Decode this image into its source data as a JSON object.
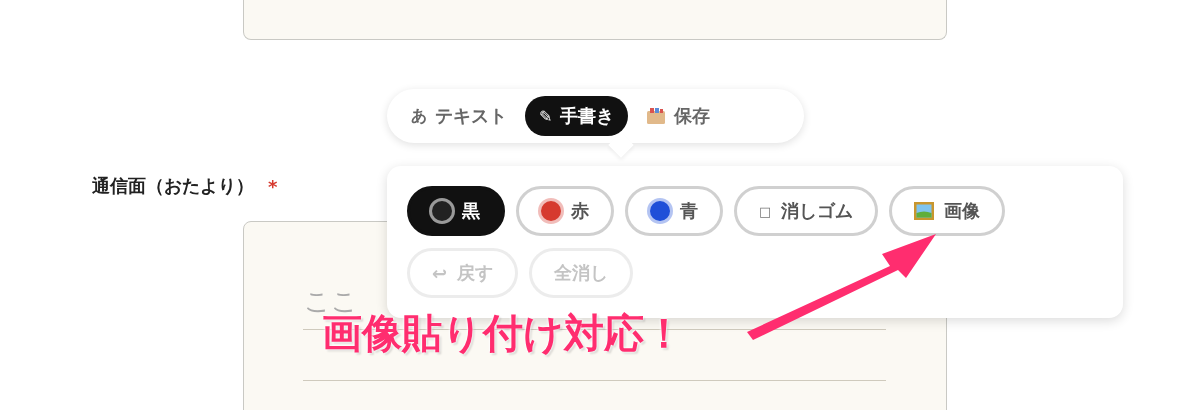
{
  "modes": [
    {
      "icon": "あ",
      "label": "テキスト",
      "kind": "text",
      "selected": false
    },
    {
      "icon": "✎",
      "label": "手書き",
      "kind": "draw",
      "selected": true
    },
    {
      "label": "保存",
      "kind": "save",
      "selected": false
    }
  ],
  "field": {
    "label": "通信面（おたより）",
    "required_mark": "*",
    "placeholder": "ここ"
  },
  "tools": [
    {
      "kind": "color",
      "label": "黒",
      "color": "#222222",
      "selected": true,
      "disabled": false
    },
    {
      "kind": "color",
      "label": "赤",
      "color": "#d63a2f",
      "selected": false,
      "disabled": false
    },
    {
      "kind": "color",
      "label": "青",
      "color": "#1f4fd8",
      "selected": false,
      "disabled": false
    },
    {
      "kind": "eraser",
      "icon": "□",
      "label": "消しゴム",
      "selected": false,
      "disabled": false
    },
    {
      "kind": "image",
      "label": "画像",
      "selected": false,
      "disabled": false
    }
  ],
  "actions": [
    {
      "icon": "↩",
      "label": "戻す",
      "disabled": true
    },
    {
      "label": "全消し",
      "disabled": true
    }
  ],
  "annotation": "画像貼り付け対応！"
}
